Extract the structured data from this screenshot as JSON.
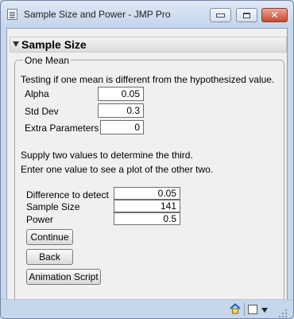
{
  "window": {
    "title": "Sample Size and Power - JMP Pro",
    "close_glyph": "✕"
  },
  "outline": {
    "title": "Sample Size"
  },
  "panel": {
    "label": "One Mean",
    "description": "Testing if one mean is different from the hypothesized value.",
    "inputs": [
      {
        "label": "Alpha",
        "value": "0.05"
      },
      {
        "label": "Std Dev",
        "value": "0.3"
      },
      {
        "label": "Extra Parameters",
        "value": "0"
      }
    ],
    "instruction_1": "Supply two values to determine the third.",
    "instruction_2": "Enter one value to see a plot of the other two.",
    "params": [
      {
        "label": "Difference to detect",
        "value": "0.05"
      },
      {
        "label": "Sample Size",
        "value": "141"
      },
      {
        "label": "Power",
        "value": "0.5"
      }
    ],
    "buttons": {
      "continue": "Continue",
      "back": "Back",
      "animation": "Animation Script"
    }
  },
  "statusbar": {
    "icons": [
      "home-icon",
      "checkbox-icon",
      "dropdown-arrow-icon"
    ]
  }
}
